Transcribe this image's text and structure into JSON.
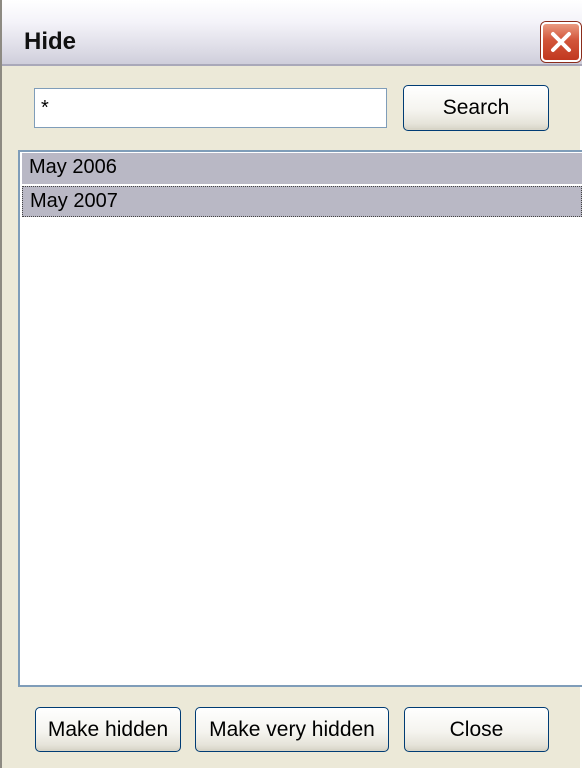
{
  "window": {
    "title": "Hide"
  },
  "search": {
    "value": "*",
    "button_label": "Search"
  },
  "list": {
    "items": [
      "May 2006",
      "May 2007"
    ]
  },
  "footer": {
    "make_hidden_label": "Make hidden",
    "make_very_hidden_label": "Make very hidden",
    "close_label": "Close"
  },
  "colors": {
    "titlebar": "#dedde7",
    "close_button": "#d2553a",
    "selected_item": "#b9b8c5",
    "input_border": "#7f9db9"
  }
}
